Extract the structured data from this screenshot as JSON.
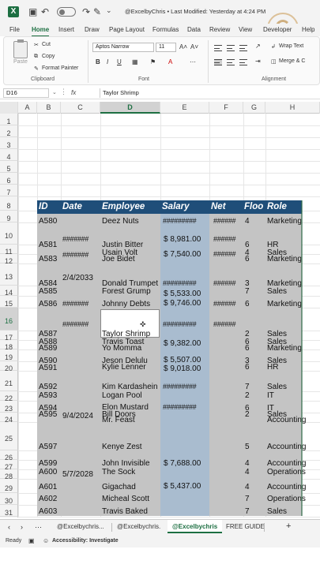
{
  "titlebar": {
    "autosave_state": "Off",
    "title": "@ExcelbyChris • Last Modified: Yesterday at 4:24 PM",
    "icons": [
      "excel-logo-icon",
      "autosave-toggle",
      "undo-icon",
      "redo-icon",
      "format-painter-icon",
      "chevron-down-icon"
    ]
  },
  "watermark": {
    "text": "@ExcelbyChris"
  },
  "ribbon_tabs": [
    "File",
    "Home",
    "Insert",
    "Draw",
    "Page Layout",
    "Formulas",
    "Data",
    "Review",
    "View",
    "Developer",
    "Help"
  ],
  "active_ribbon_tab": "Home",
  "ribbon": {
    "clipboard": {
      "paste": "Paste",
      "cut": "Cut",
      "copy": "Copy",
      "format_painter": "Format Painter",
      "label": "Clipboard"
    },
    "font": {
      "name": "Aptos Narrow",
      "size": "11",
      "bold": "B",
      "italic": "I",
      "underline": "U",
      "grow": "A˄",
      "shrink": "A˅",
      "label": "Font"
    },
    "alignment": {
      "wrap_text": "Wrap Text",
      "merge": "Merge & C",
      "label": "Alignment"
    }
  },
  "formula_bar": {
    "name_box": "D16",
    "fx": "fx",
    "value": "Taylor Shrimp"
  },
  "columns": [
    "A",
    "B",
    "C",
    "D",
    "E",
    "F",
    "G",
    "H"
  ],
  "selected_column": "D",
  "selected_row": "16",
  "rows": [
    "1",
    "2",
    "3",
    "4",
    "5",
    "6",
    "7",
    "8",
    "9",
    "10",
    "11",
    "12",
    "13",
    "14",
    "15",
    "16",
    "17",
    "18",
    "19",
    "20",
    "21",
    "22",
    "23",
    "24",
    "25",
    "26",
    "27",
    "28",
    "29",
    "30",
    "31",
    "32"
  ],
  "table": {
    "headers": [
      "ID",
      "Date",
      "Employee",
      "Salary",
      "Net",
      "Floo",
      "Role"
    ],
    "visible_text": [
      {
        "t": "A580"
      },
      {
        "t": "Deez Nuts"
      },
      {
        "t": "#########"
      },
      {
        "t": "######"
      },
      {
        "t": "4"
      },
      {
        "t": "Marketing"
      },
      {
        "t": "A581"
      },
      {
        "t": "#######"
      },
      {
        "t": "Justin Bitter"
      },
      {
        "t": "$ 8,981.00"
      },
      {
        "t": "######"
      },
      {
        "t": "6"
      },
      {
        "t": "HR"
      },
      {
        "t": "#######"
      },
      {
        "t": "Usain Volt"
      },
      {
        "t": "$ 7,540.00"
      },
      {
        "t": "######"
      },
      {
        "t": "4"
      },
      {
        "t": "Sales"
      },
      {
        "t": "A583"
      },
      {
        "t": "Joe Bidet"
      },
      {
        "t": "6"
      },
      {
        "t": "Marketing"
      },
      {
        "t": "2/4/2033"
      },
      {
        "t": "A584"
      },
      {
        "t": "Donald Trumpet"
      },
      {
        "t": "#########"
      },
      {
        "t": "######"
      },
      {
        "t": "3"
      },
      {
        "t": "Marketing"
      },
      {
        "t": "A585"
      },
      {
        "t": "Forest Grump"
      },
      {
        "t": "$ 5,533.00"
      },
      {
        "t": "7"
      },
      {
        "t": "Sales"
      },
      {
        "t": "A586"
      },
      {
        "t": "#######"
      },
      {
        "t": "Johnny Debts"
      },
      {
        "t": "$ 9,746.00"
      },
      {
        "t": "######"
      },
      {
        "t": "6"
      },
      {
        "t": "Marketing"
      },
      {
        "t": "#######"
      },
      {
        "t": "#########"
      },
      {
        "t": "######"
      },
      {
        "t": "A587"
      },
      {
        "t": "Taylor Shrimp"
      },
      {
        "t": "2"
      },
      {
        "t": "Sales"
      },
      {
        "t": "A588"
      },
      {
        "t": "Travis Toast"
      },
      {
        "t": "$ 9,382.00"
      },
      {
        "t": "6"
      },
      {
        "t": "Sales"
      },
      {
        "t": "A589"
      },
      {
        "t": "Yo Momma"
      },
      {
        "t": "6"
      },
      {
        "t": "Marketing"
      },
      {
        "t": "A590"
      },
      {
        "t": "Jeson Delulu"
      },
      {
        "t": "$ 5,507.00"
      },
      {
        "t": "3"
      },
      {
        "t": "Sales"
      },
      {
        "t": "A591"
      },
      {
        "t": "Kylie Lenner"
      },
      {
        "t": "$ 9,018.00"
      },
      {
        "t": "6"
      },
      {
        "t": "HR"
      },
      {
        "t": "A592"
      },
      {
        "t": "Kim Kardashein"
      },
      {
        "t": "#########"
      },
      {
        "t": "7"
      },
      {
        "t": "Sales"
      },
      {
        "t": "A593"
      },
      {
        "t": "Logan Pool"
      },
      {
        "t": "2"
      },
      {
        "t": "IT"
      },
      {
        "t": "A594"
      },
      {
        "t": "Elon Mustard"
      },
      {
        "t": "#########"
      },
      {
        "t": "6"
      },
      {
        "t": "IT"
      },
      {
        "t": "A595"
      },
      {
        "t": "9/4/2024"
      },
      {
        "t": "Bill Doors"
      },
      {
        "t": "2"
      },
      {
        "t": "Sales"
      },
      {
        "t": "Mr. Feast"
      },
      {
        "t": "Accounting"
      },
      {
        "t": "A597"
      },
      {
        "t": "Kenye Zest"
      },
      {
        "t": "5"
      },
      {
        "t": "Accounting"
      },
      {
        "t": "A599"
      },
      {
        "t": "John Invisible"
      },
      {
        "t": "$ 7,688.00"
      },
      {
        "t": "4"
      },
      {
        "t": "Accounting"
      },
      {
        "t": "A600"
      },
      {
        "t": "5/7/2028"
      },
      {
        "t": "The Sock"
      },
      {
        "t": "4"
      },
      {
        "t": "Operations"
      },
      {
        "t": "A601"
      },
      {
        "t": "Gigachad"
      },
      {
        "t": "$ 5,437.00"
      },
      {
        "t": "4"
      },
      {
        "t": "Accounting"
      },
      {
        "t": "A602"
      },
      {
        "t": "Micheal Scott"
      },
      {
        "t": "7"
      },
      {
        "t": "Operations"
      },
      {
        "t": "A603"
      },
      {
        "t": "Travis Baked"
      },
      {
        "t": "7"
      },
      {
        "t": "Sales"
      }
    ]
  },
  "sheet_tabs": [
    "@Excelbychris...",
    "@Excelbychris.",
    "@Excelbychris",
    "FREE GUIDE"
  ],
  "active_sheet": "@Excelbychris",
  "status_bar": {
    "ready": "Ready",
    "accessibility": "Accessibility: Investigate"
  }
}
